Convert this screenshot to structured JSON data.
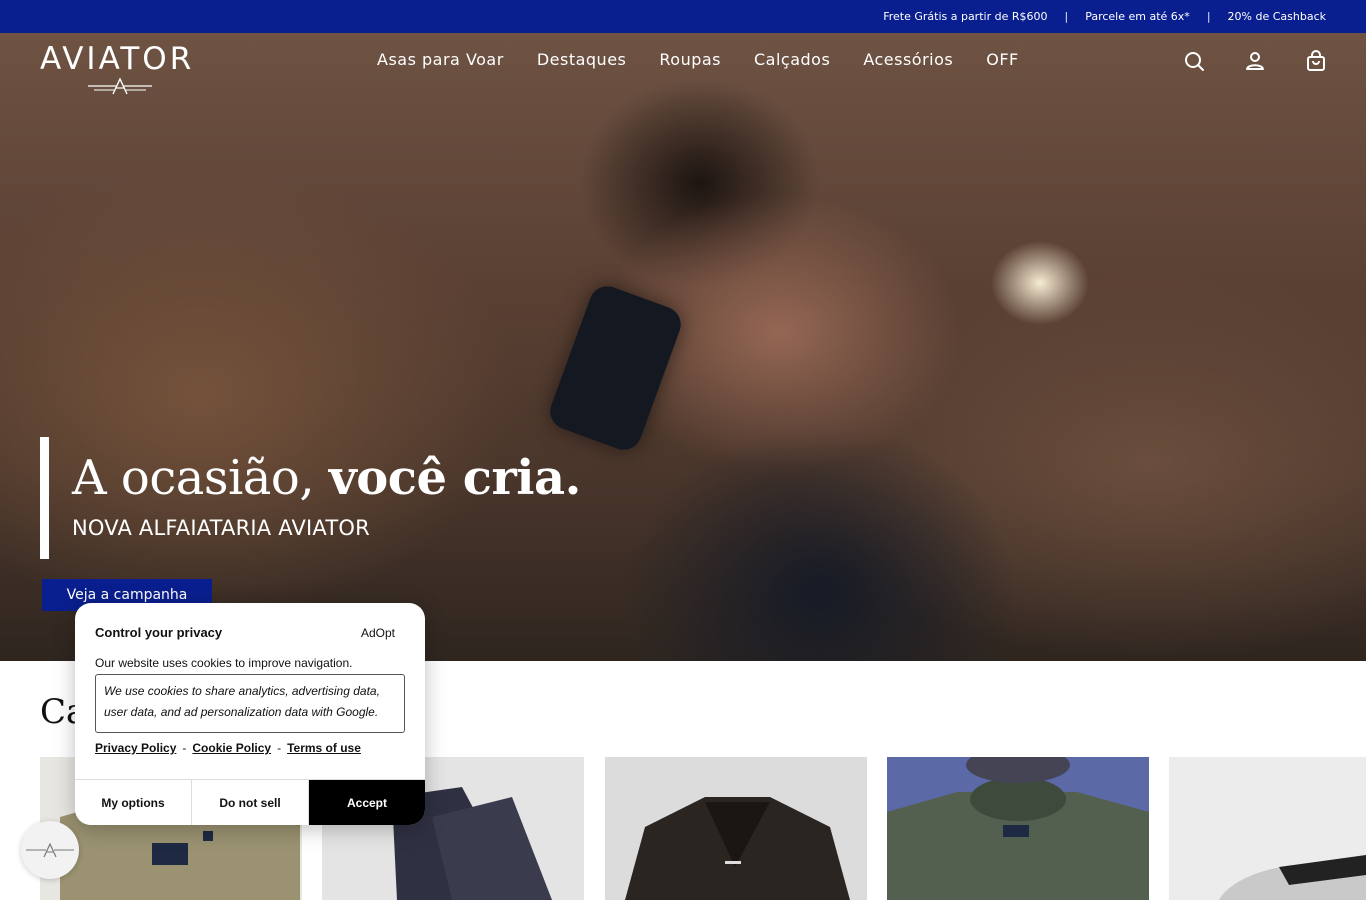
{
  "topbar": {
    "promo_1": "Frete Grátis a partir de R$600",
    "separator": "|",
    "promo_2": "Parcele em até 6x*",
    "promo_3": "20% de Cashback",
    "background": "#0a1f8f"
  },
  "header": {
    "logo_text": "AVIATOR",
    "nav": [
      "Asas para Voar",
      "Destaques",
      "Roupas",
      "Calçados",
      "Acessórios",
      "OFF"
    ],
    "icons": [
      "search-icon",
      "user-icon",
      "shopping-bag-icon"
    ]
  },
  "hero": {
    "title_light": "A ocasião,",
    "title_bold": "você cria.",
    "subtitle": "NOVA ALFAIATARIA AVIATOR",
    "cta_label": "Veja a campanha",
    "cta_color": "#0a1f8f"
  },
  "categories": {
    "title_partial": "Ca",
    "cards": [
      "shirt",
      "pants",
      "leather-jacket",
      "t-shirts",
      "sneakers"
    ]
  },
  "cookie": {
    "title": "Control your privacy",
    "brand": "AdOpt",
    "intro": "Our website uses cookies to improve navigation.",
    "details": "We use cookies to share analytics, advertising data, user data, and ad personalization data with Google.",
    "links": [
      "Privacy Policy",
      "Cookie Policy",
      "Terms of use"
    ],
    "link_separator": "-",
    "buttons": {
      "options": "My options",
      "do_not_sell": "Do not sell",
      "accept": "Accept"
    }
  }
}
